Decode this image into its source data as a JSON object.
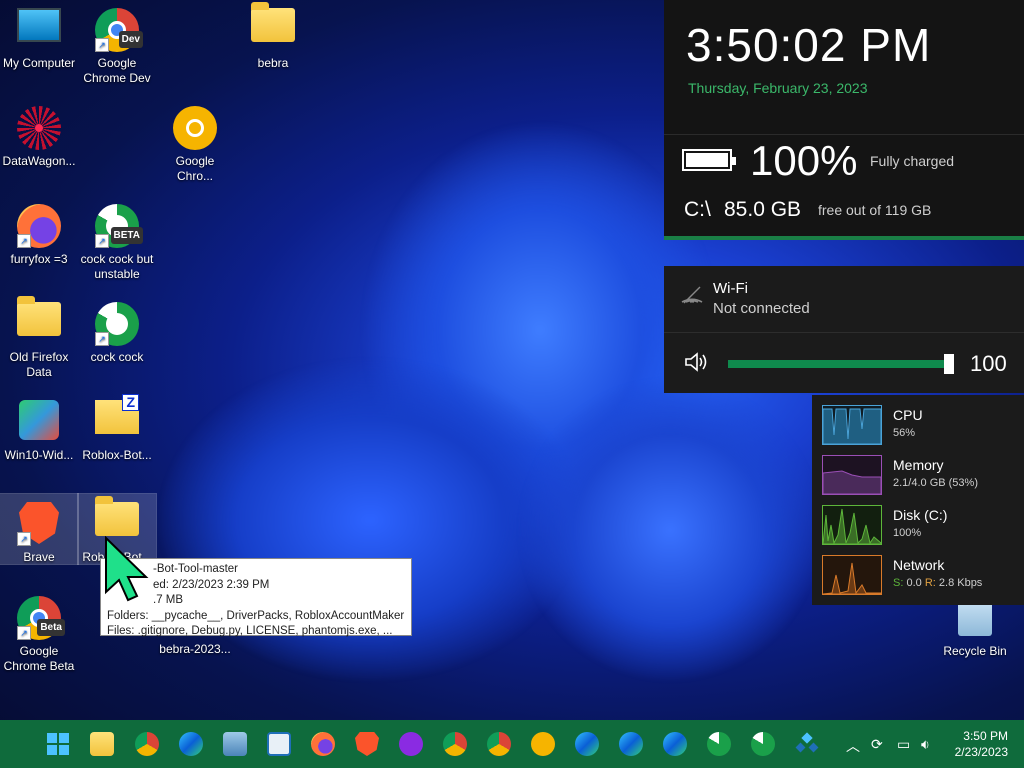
{
  "desktop": {
    "icons": [
      {
        "label": "My Computer"
      },
      {
        "label": "Google Chrome Dev",
        "tag": "Dev"
      },
      {
        "label": "bebra"
      },
      {
        "label": "DataWagon..."
      },
      {
        "label": "Google Chro..."
      },
      {
        "label": "furryfox =3"
      },
      {
        "label": "cock cock but unstable",
        "tag": "BETA"
      },
      {
        "label": "Old Firefox Data"
      },
      {
        "label": "cock cock"
      },
      {
        "label": "Win10-Wid..."
      },
      {
        "label": "Roblox-Bot..."
      },
      {
        "label": "Brave"
      },
      {
        "label": "Roblox-Bot..."
      },
      {
        "label": "Google Chrome Beta",
        "tag": "Beta"
      },
      {
        "label": "bebra-2023..."
      },
      {
        "label": "Recycle Bin"
      }
    ]
  },
  "tooltip": {
    "line1": "-Bot-Tool-master",
    "line2": "ed: 2/23/2023 2:39 PM",
    "line3": ".7 MB",
    "line4": "Folders: __pycache__, DriverPacks, RobloxAccountMaker",
    "line5": "Files: .gitignore, Debug.py, LICENSE, phantomjs.exe, ..."
  },
  "clock_panel": {
    "time": "3:50:02 PM",
    "date": "Thursday, February 23, 2023",
    "battery_percent": "100%",
    "battery_status": "Fully charged",
    "disk_drive": "C:\\",
    "disk_free": "85.0 GB",
    "disk_total": "free out of 119 GB"
  },
  "wifi": {
    "title": "Wi-Fi",
    "status": "Not connected"
  },
  "volume": {
    "value": "100",
    "level": 1.0
  },
  "performance": [
    {
      "name": "CPU",
      "value": "56%",
      "color": "#4aa3d8"
    },
    {
      "name": "Memory",
      "value": "2.1/4.0 GB (53%)",
      "color": "#9b4fb6"
    },
    {
      "name": "Disk (C:)",
      "value": "100%",
      "color": "#5db53a"
    },
    {
      "name": "Network",
      "value_prefix_s": "S:",
      "value_s": "0.0",
      "value_prefix_r": "R:",
      "value_r": "2.8 Kbps",
      "color": "#d87a2a"
    }
  ],
  "taskbar": {
    "time": "3:50 PM",
    "date": "2/23/2023",
    "accent": "#0f6b3c"
  }
}
